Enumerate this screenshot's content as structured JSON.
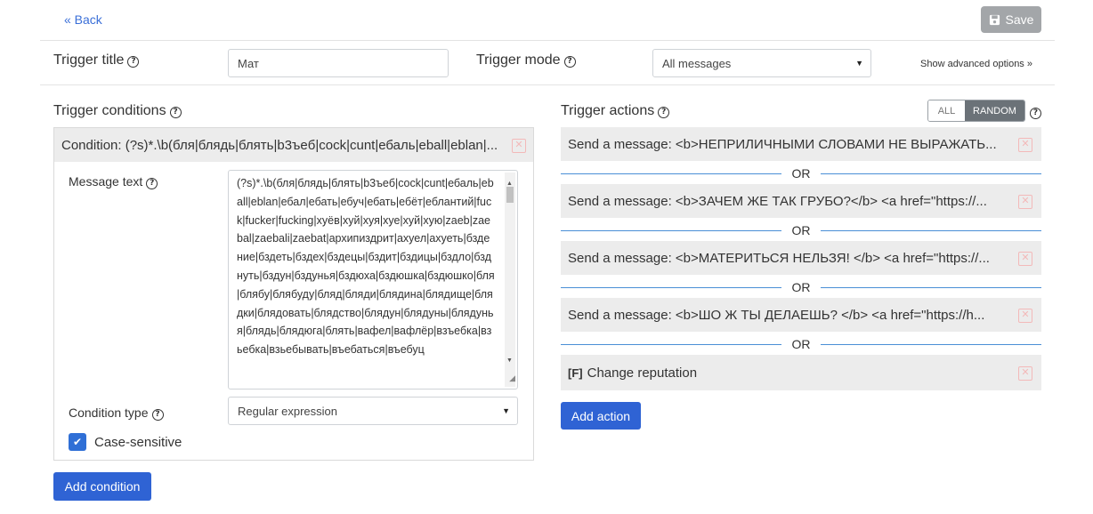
{
  "header": {
    "back_label": "« Back",
    "save_label": "Save"
  },
  "settings": {
    "trigger_title_label": "Trigger title",
    "trigger_title_value": "Мат",
    "trigger_mode_label": "Trigger mode",
    "trigger_mode_value": "All messages",
    "advanced_link": "Show advanced options »"
  },
  "conditions": {
    "section_label": "Trigger conditions",
    "condition_header": "Condition: (?s)*.\\b(бля|блядь|блять|b3ъeб|cock|cunt|ебаль|eball|eblan|...",
    "message_text_label": "Message text",
    "message_text_value": "(?s)*.\\b(бля|блядь|блять|b3ъeб|cock|cunt|ебаль|eball|eblan|ебал|ебать|ебуч|ебать|ебёт|еблантий|fuck|fucker|fucking|хуёв|хуй|хуя|хуе|хуй|хую|zaeb|zaebal|zaebali|zaebat|архипиздрит|ахуел|ахуеть|бздение|бздеть|бздех|бздецы|бздит|бздицы|бздло|бзднуть|бздун|бздунья|бздюха|бздюшка|бздюшко|бля|блябу|блябуду|бляд|бляди|блядина|блядище|блядки|блядовать|блядство|блядун|блядуны|блядунья|блядь|блядюга|блять|вафел|вафлёр|взъебка|взьебка|взьебывать|въебаться|въебуц",
    "condition_type_label": "Condition type",
    "condition_type_value": "Regular expression",
    "case_sensitive_label": "Case-sensitive",
    "add_condition_label": "Add condition"
  },
  "actions": {
    "section_label": "Trigger actions",
    "toggle_all": "ALL",
    "toggle_random": "RANDOM",
    "items": [
      "Send a message: <b>НЕПРИЛИЧНЫМИ СЛОВАМИ НЕ ВЫРАЖАТЬ...",
      "Send a message: <b>ЗАЧЕМ ЖЕ ТАК ГРУБО?</b>  <a href=\"https://...",
      "Send a message: <b>МАТЕРИТЬСЯ НЕЛЬЗЯ! </b>  <a href=\"https://...",
      "Send a message: <b>ШО Ж ТЫ ДЕЛАЕШЬ? </b>  <a href=\"https://h..."
    ],
    "reputation_prefix": "[F]",
    "reputation_label": "Change reputation",
    "or_label": "OR",
    "add_action_label": "Add action"
  },
  "colors": {
    "primary": "#2f63d4",
    "save_disabled": "#a3a6a9",
    "or_line": "#4a8fd6",
    "row_bg": "#ececec"
  }
}
